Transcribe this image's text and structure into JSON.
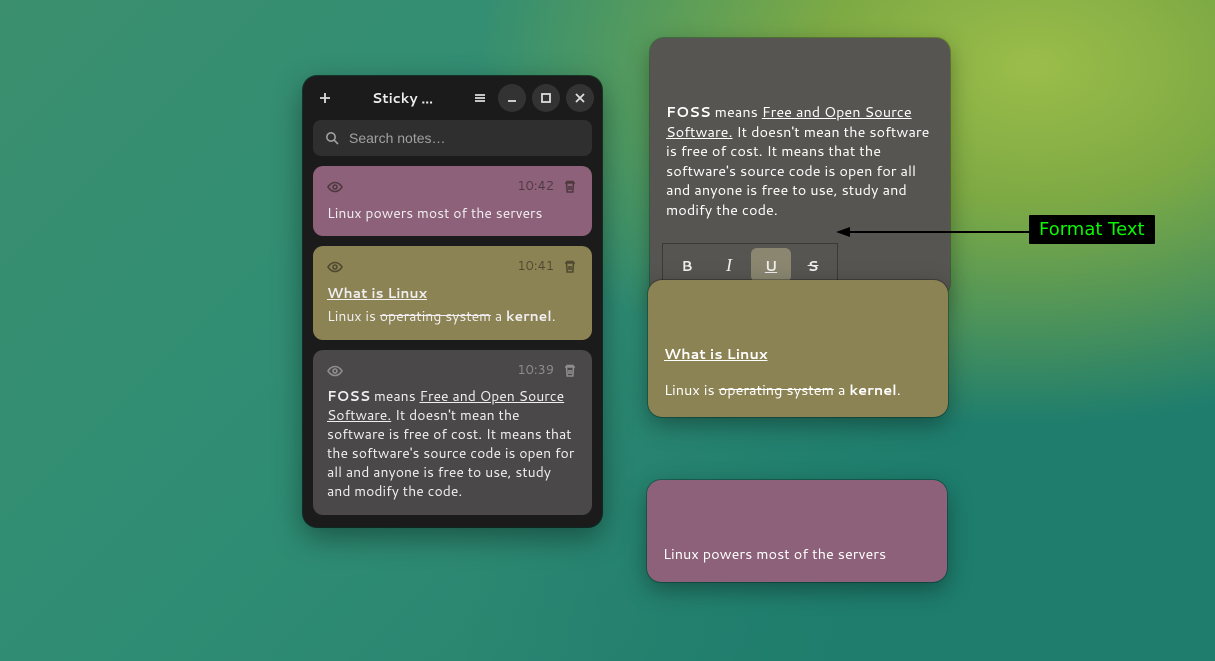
{
  "app": {
    "title": "Sticky …",
    "search_placeholder": "Search notes…"
  },
  "colors": {
    "purple": "#8d6179",
    "olive": "#8c8354",
    "darkgray": "#4a4848",
    "stickygray": "#575551"
  },
  "notes_list": [
    {
      "id": "note-linux-servers",
      "color": "purple",
      "time": "10:42",
      "body_plain": "Linux powers most of the servers"
    },
    {
      "id": "note-what-is-linux",
      "color": "olive",
      "time": "10:41",
      "title": "What is Linux",
      "line": {
        "pre": "Linux is ",
        "strike": "operating system",
        "mid": " a ",
        "bold": "kernel",
        "post": "."
      }
    },
    {
      "id": "note-foss",
      "color": "gray",
      "time": "10:39",
      "foss": {
        "bold": "FOSS",
        "means": " means ",
        "underline": "Free and Open Source Software.",
        "rest": " It doesn't mean the software is free of cost. It means that the software's source code is open for all and anyone is free to use, study and modify the code."
      }
    }
  ],
  "sticky_foss": {
    "bold": "FOSS",
    "means": " means ",
    "underline": "Free and Open Source Software.",
    "rest": " It doesn't mean the software is free of cost. It means that the software's source code is open for all and anyone is free to use, study and modify the code."
  },
  "sticky_linux": {
    "title": "What is Linux",
    "pre": "Linux is ",
    "strike": "operating system",
    "mid": " a ",
    "bold": "kernel",
    "post": "."
  },
  "sticky_servers": {
    "body": "Linux powers most of the servers"
  },
  "format_bar": {
    "bold": "B",
    "italic": "I",
    "underline": "U",
    "strike": "S",
    "active": "underline"
  },
  "annotation": {
    "label": "Format Text"
  }
}
